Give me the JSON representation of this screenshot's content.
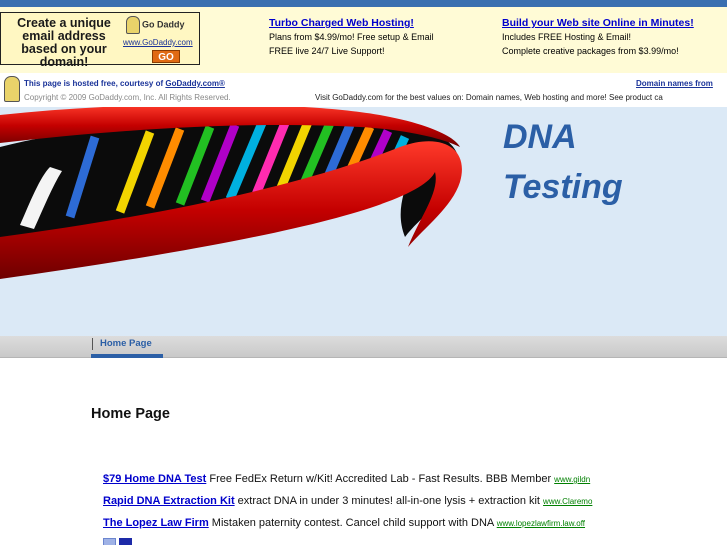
{
  "promo": {
    "text": "Create a unique email address based on your domain!",
    "logo": "Go Daddy",
    "url": "www.GoDaddy.com",
    "go_label": "GO"
  },
  "ads_top": [
    {
      "title": "Turbo Charged Web Hosting!",
      "line1": "Plans from $4.99/mo! Free setup & Email",
      "line2": "FREE live 24/7 Live Support!"
    },
    {
      "title": "Build your Web site Online in Minutes!",
      "line1": "Includes FREE Hosting & Email!",
      "line2": "Complete creative packages from $3.99/mo!"
    }
  ],
  "hosting": {
    "line1_prefix": "This page is hosted free, courtesy of ",
    "line1_link": "GoDaddy.com®",
    "copyright": "Copyright © 2009 GoDaddy.com, Inc. All Rights Reserved.",
    "right_link": "Domain names from",
    "visit_prefix": "Visit ",
    "visit_link": "GoDaddy.com",
    "visit_mid": " for the best values on: ",
    "link_domains": "Domain names",
    "comma": ", ",
    "link_hosting": "Web hosting",
    "visit_suffix": " and more! See ",
    "link_catalog": "product ca"
  },
  "site": {
    "title_line1": "DNA",
    "title_line2": "Testing"
  },
  "nav": {
    "items": [
      {
        "label": "Home Page"
      }
    ]
  },
  "page": {
    "heading": "Home Page"
  },
  "ads_main": [
    {
      "title": "$79 Home DNA Test",
      "desc": " Free FedEx Return w/Kit! Accredited Lab - Fast Results. BBB Member ",
      "url": "www.gildn"
    },
    {
      "title": "Rapid DNA Extraction Kit",
      "desc": " extract DNA in under 3 minutes! all-in-one lysis + extraction kit ",
      "url": "www.Claremo"
    },
    {
      "title": "The Lopez Law Firm",
      "desc": " Mistaken paternity contest. Cancel child support with DNA ",
      "url": "www.lopezlawfirm.law.off"
    }
  ],
  "colors": {
    "accent": "#2b5fa6",
    "link": "#0000cc",
    "banner_bg": "#dbe9f6",
    "ad_url": "#008000",
    "promo_bg": "#fff7c2"
  }
}
